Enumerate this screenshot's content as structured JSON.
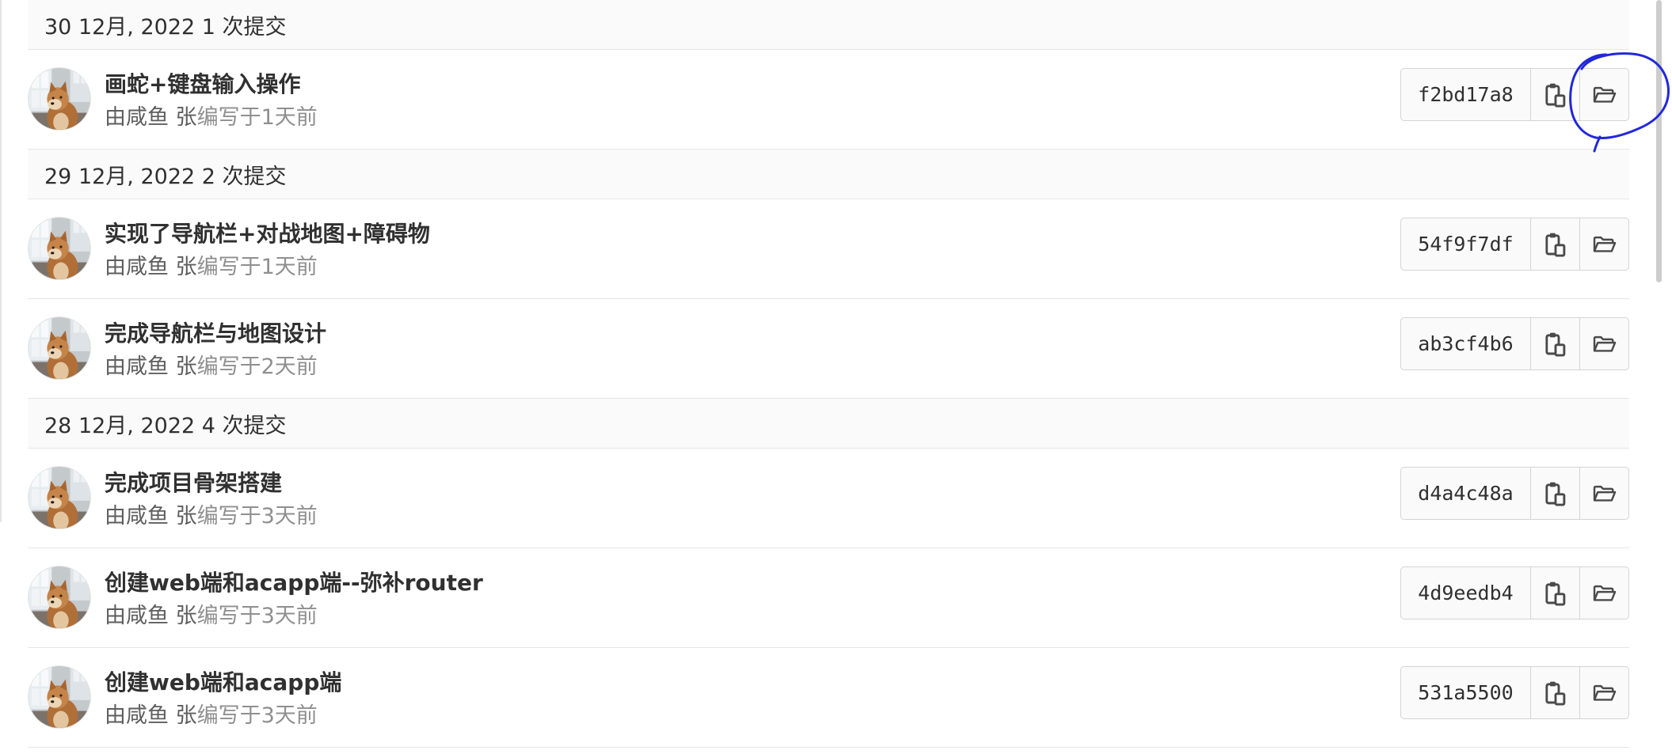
{
  "groups": [
    {
      "header": "30 12月, 2022 1 次提交",
      "commits": [
        {
          "title": "画蛇+键盘输入操作",
          "author": "由咸鱼 张",
          "authored": "编写于1天前",
          "sha": "f2bd17a8"
        }
      ]
    },
    {
      "header": "29 12月, 2022 2 次提交",
      "commits": [
        {
          "title": "实现了导航栏+对战地图+障碍物",
          "author": "由咸鱼 张",
          "authored": "编写于1天前",
          "sha": "54f9f7df"
        },
        {
          "title": "完成导航栏与地图设计",
          "author": "由咸鱼 张",
          "authored": "编写于2天前",
          "sha": "ab3cf4b6"
        }
      ]
    },
    {
      "header": "28 12月, 2022 4 次提交",
      "commits": [
        {
          "title": "完成项目骨架搭建",
          "author": "由咸鱼 张",
          "authored": "编写于3天前",
          "sha": "d4a4c48a"
        },
        {
          "title": "创建web端和acapp端--弥补router",
          "author": "由咸鱼 张",
          "authored": "编写于3天前",
          "sha": "4d9eedb4"
        },
        {
          "title": "创建web端和acapp端",
          "author": "由咸鱼 张",
          "authored": "编写于3天前",
          "sha": "531a5500"
        }
      ]
    }
  ],
  "icons": {
    "copy_button": "clipboard-icon",
    "browse_button": "folder-open-icon",
    "avatar": "dog-photo-avatar"
  },
  "colors": {
    "header_background": "#fafafa",
    "row_border": "#e6e6e6",
    "button_border": "#d4d4d4",
    "title_text": "#303030",
    "muted_text": "#8f8f8f",
    "annotation_ink": "#2228d8"
  }
}
